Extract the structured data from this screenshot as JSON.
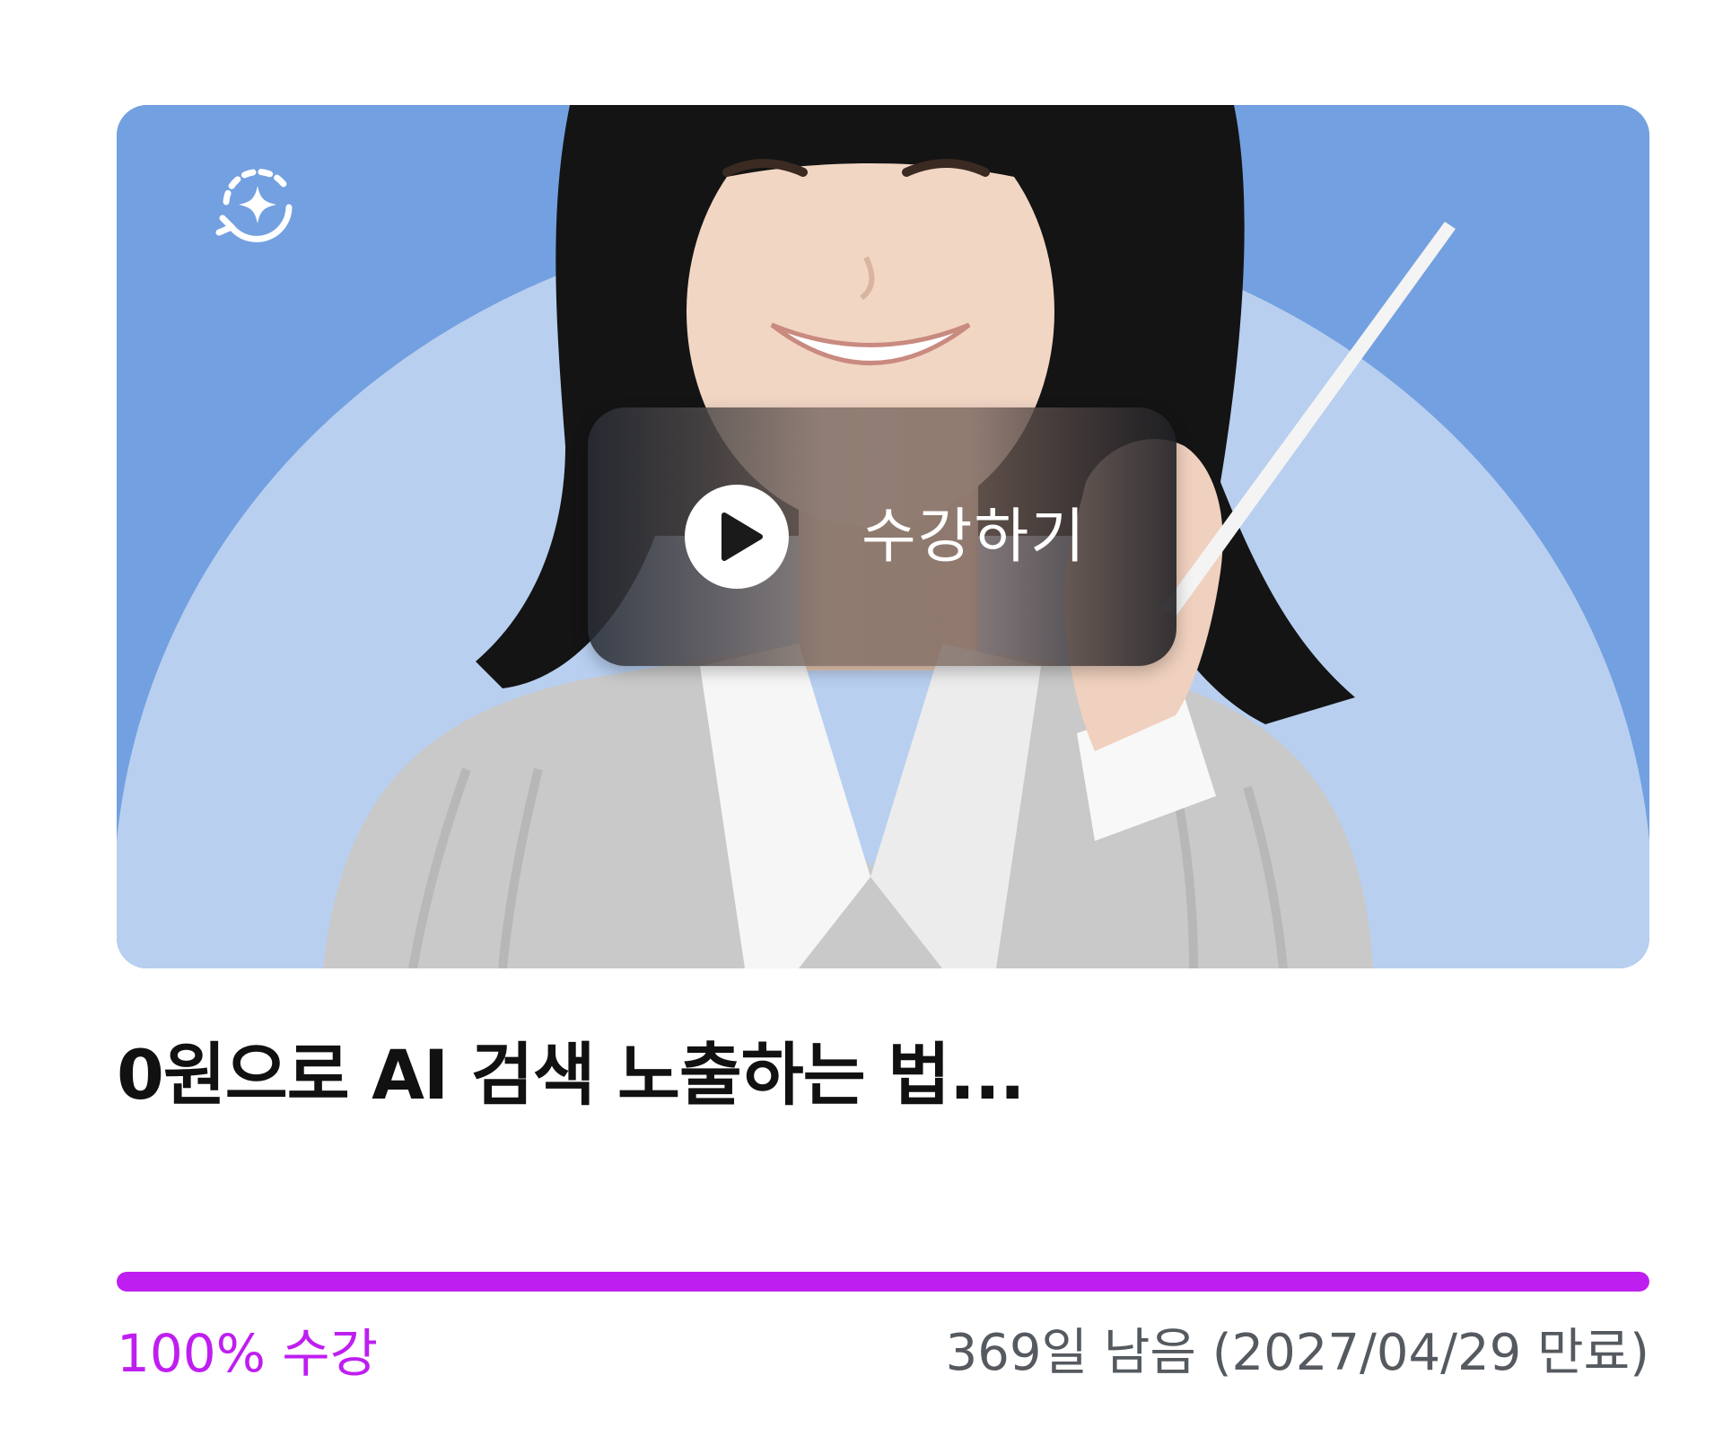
{
  "course": {
    "play_label": "수강하기",
    "title": "0원으로 AI 검색 노출하는 법...",
    "progress_percent": 100,
    "progress_label": "100% 수강",
    "remaining": "369일 남음 (2027/04/29 만료)"
  },
  "icons": {
    "badge": "ai-sparkle-refresh-icon",
    "play": "play-icon"
  },
  "colors": {
    "accent": "#bf1ef0",
    "thumbnail_bg": "#73a0e0",
    "thumbnail_arch": "#b8cff0",
    "title": "#111111",
    "remaining_text": "#555a60"
  }
}
